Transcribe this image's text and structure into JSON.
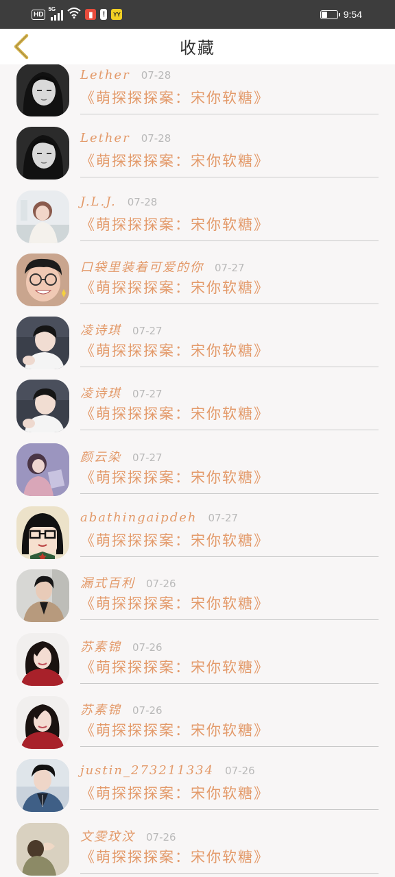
{
  "status_bar": {
    "hd": "HD",
    "network": "5G",
    "app_icons": [
      {
        "name": "red-book-icon",
        "color": "#e74c3c",
        "glyph": "▮"
      },
      {
        "name": "exclaim-icon",
        "color": "#ffffff",
        "glyph": "!"
      },
      {
        "name": "yy-icon",
        "color": "#f2d024",
        "glyph": "YY"
      }
    ],
    "battery_level": 0.35,
    "time": "9:54"
  },
  "header": {
    "title": "收藏"
  },
  "colors": {
    "accent": "#e39a6a",
    "back_arrow": "#d5b24a",
    "date_gray": "#b9b9b9",
    "divider": "#c9c9c9"
  },
  "items": [
    {
      "user": "Lether",
      "date": "07-28",
      "title": "《萌探探探案：宋你软糖》",
      "avatar": "dark-girl"
    },
    {
      "user": "Lether",
      "date": "07-28",
      "title": "《萌探探探案：宋你软糖》",
      "avatar": "dark-girl"
    },
    {
      "user": "J.L.J.",
      "date": "07-28",
      "title": "《萌探探探案：宋你软糖》",
      "avatar": "light-girl"
    },
    {
      "user": "口袋里装着可爱的你",
      "date": "07-27",
      "title": "《萌探探探案：宋你软糖》",
      "avatar": "glasses-boy"
    },
    {
      "user": "凌诗琪",
      "date": "07-27",
      "title": "《萌探探探案：宋你软糖》",
      "avatar": "boy-white"
    },
    {
      "user": "凌诗琪",
      "date": "07-27",
      "title": "《萌探探探案：宋你软糖》",
      "avatar": "boy-white"
    },
    {
      "user": "颜云染",
      "date": "07-27",
      "title": "《萌探探探案：宋你软糖》",
      "avatar": "purple-girl"
    },
    {
      "user": "abathingaipdeh",
      "date": "07-27",
      "title": "《萌探探探案：宋你软糖》",
      "avatar": "cartoon"
    },
    {
      "user": "漏式百利",
      "date": "07-26",
      "title": "《萌探探探案：宋你软糖》",
      "avatar": "boy-coat"
    },
    {
      "user": "苏素锦",
      "date": "07-26",
      "title": "《萌探探探案：宋你软糖》",
      "avatar": "red-girl"
    },
    {
      "user": "苏素锦",
      "date": "07-26",
      "title": "《萌探探探案：宋你软糖》",
      "avatar": "red-girl"
    },
    {
      "user": "justin_273211334",
      "date": "07-26",
      "title": "《萌探探探案：宋你软糖》",
      "avatar": "boy-denim"
    },
    {
      "user": "文雯玟汶",
      "date": "07-26",
      "title": "《萌探探探案：宋你软糖》",
      "avatar": "olive-girl"
    }
  ]
}
